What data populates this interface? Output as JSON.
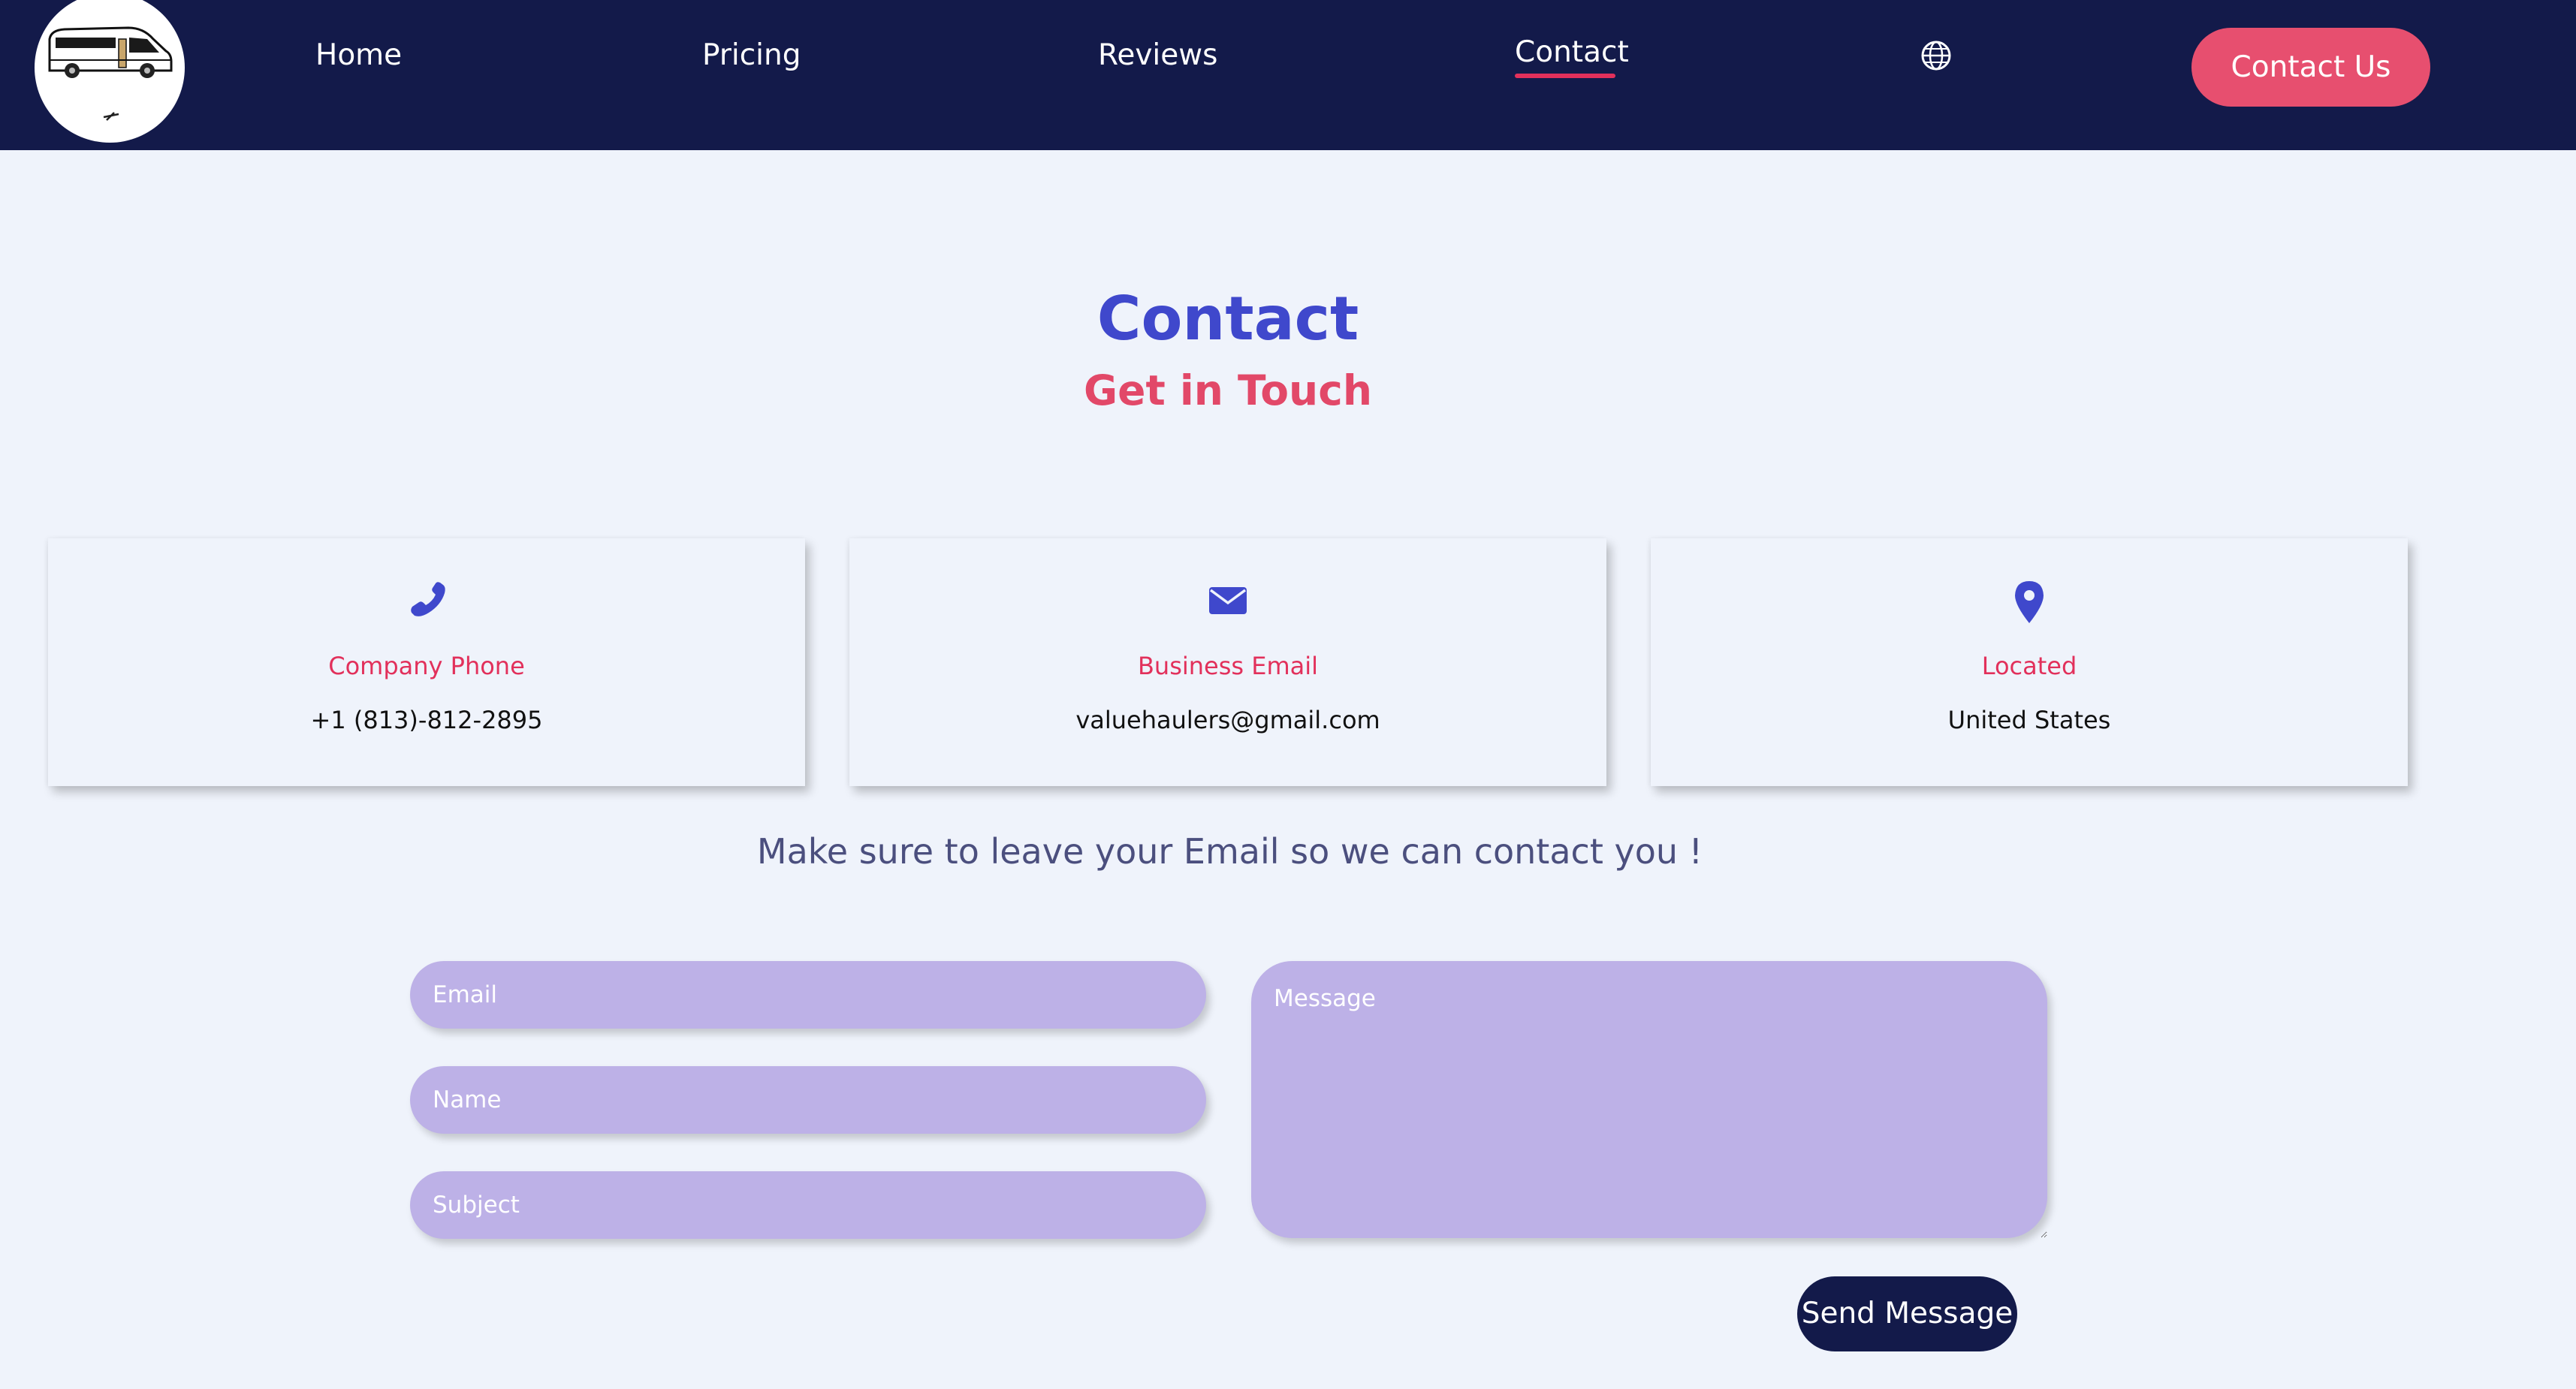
{
  "nav": {
    "links": [
      "Home",
      "Pricing",
      "Reviews",
      "Contact"
    ],
    "active": "Contact",
    "language_icon": "globe-icon",
    "cta_label": "Contact Us"
  },
  "header": {
    "title": "Contact",
    "subtitle": "Get in Touch"
  },
  "cards": [
    {
      "icon": "phone-icon",
      "label": "Company Phone",
      "value": "+1 (813)-812-2895"
    },
    {
      "icon": "envelope-icon",
      "label": "Business Email",
      "value": "valuehaulers@gmail.com"
    },
    {
      "icon": "map-pin-icon",
      "label": "Located",
      "value": "United States"
    }
  ],
  "form": {
    "note": "Make sure to leave your Email so we can contact you !",
    "email_placeholder": "Email",
    "name_placeholder": "Name",
    "subject_placeholder": "Subject",
    "message_placeholder": "Message",
    "submit_label": "Send Message"
  },
  "colors": {
    "navbar": "#131a4a",
    "accent": "#e74f6f",
    "title": "#3f48cc",
    "subtitle": "#e24868",
    "field": "#bdb1e7",
    "background": "#eff3fb"
  }
}
